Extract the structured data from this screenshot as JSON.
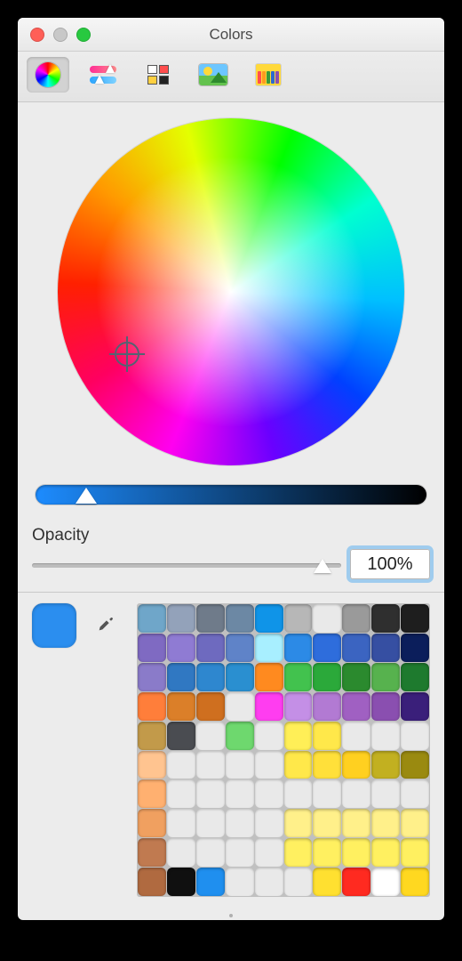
{
  "window": {
    "title": "Colors"
  },
  "tabs": [
    {
      "name": "wheel",
      "selected": true
    },
    {
      "name": "sliders",
      "selected": false
    },
    {
      "name": "palettes",
      "selected": false
    },
    {
      "name": "image",
      "selected": false
    },
    {
      "name": "crayons",
      "selected": false
    }
  ],
  "brightness_slider": {
    "position_pct": 13
  },
  "opacity": {
    "label": "Opacity",
    "value": "100%",
    "position_pct": 94
  },
  "current_color": "#2b8eef",
  "swatch_grid": {
    "cols": 10,
    "rows": 10,
    "cells": [
      "#6fa6c9",
      "#93a2ba",
      "#6f7b8a",
      "#6c88a4",
      "#0f94e8",
      "#b7b7b7",
      "",
      "#9a9a9a",
      "#2f2f2f",
      "#1e1e1e",
      "#7f6ac2",
      "#8f7bd3",
      "#6e6abf",
      "#5f83c8",
      "#a8efff",
      "#2c8ae6",
      "#2e6ddc",
      "#3b64c1",
      "#364fa2",
      "#0b1e5b",
      "#8a7bc9",
      "#3078c2",
      "#2e87cf",
      "#2a8fd0",
      "#ff8a1f",
      "#42c24e",
      "#2ba93a",
      "#2b8a2e",
      "#57b24e",
      "#1e7a2e",
      "#ff7e3a",
      "#db7f29",
      "#cf6f1f",
      "",
      "#ff3df0",
      "#c48fe6",
      "#b27ad3",
      "#a060c2",
      "#8a4fb0",
      "#3a1f7a",
      "#c29a4a",
      "#4a4c51",
      "",
      "#6ed86e",
      "",
      "#ffef57",
      "#ffe84a",
      "",
      "",
      "",
      "#ffc490",
      "",
      "",
      "",
      "",
      "#ffe84a",
      "#ffe03a",
      "#ffd020",
      "#c2b020",
      "#9a8a10",
      "#ffb070",
      "",
      "",
      "",
      "",
      "",
      "",
      "",
      "",
      "",
      "#f0a060",
      "",
      "",
      "",
      "",
      "#fff08a",
      "#fff08a",
      "#fff08a",
      "#fff08a",
      "#fff08a",
      "#c07a50",
      "",
      "",
      "",
      "",
      "#fff060",
      "#fff060",
      "#fff060",
      "#fff060",
      "#fff060",
      "#b06a40",
      "#101010",
      "#1f8fef",
      "",
      "",
      "",
      "#ffe030",
      "#ff2a20",
      "#ffffff",
      "#ffd820"
    ]
  }
}
